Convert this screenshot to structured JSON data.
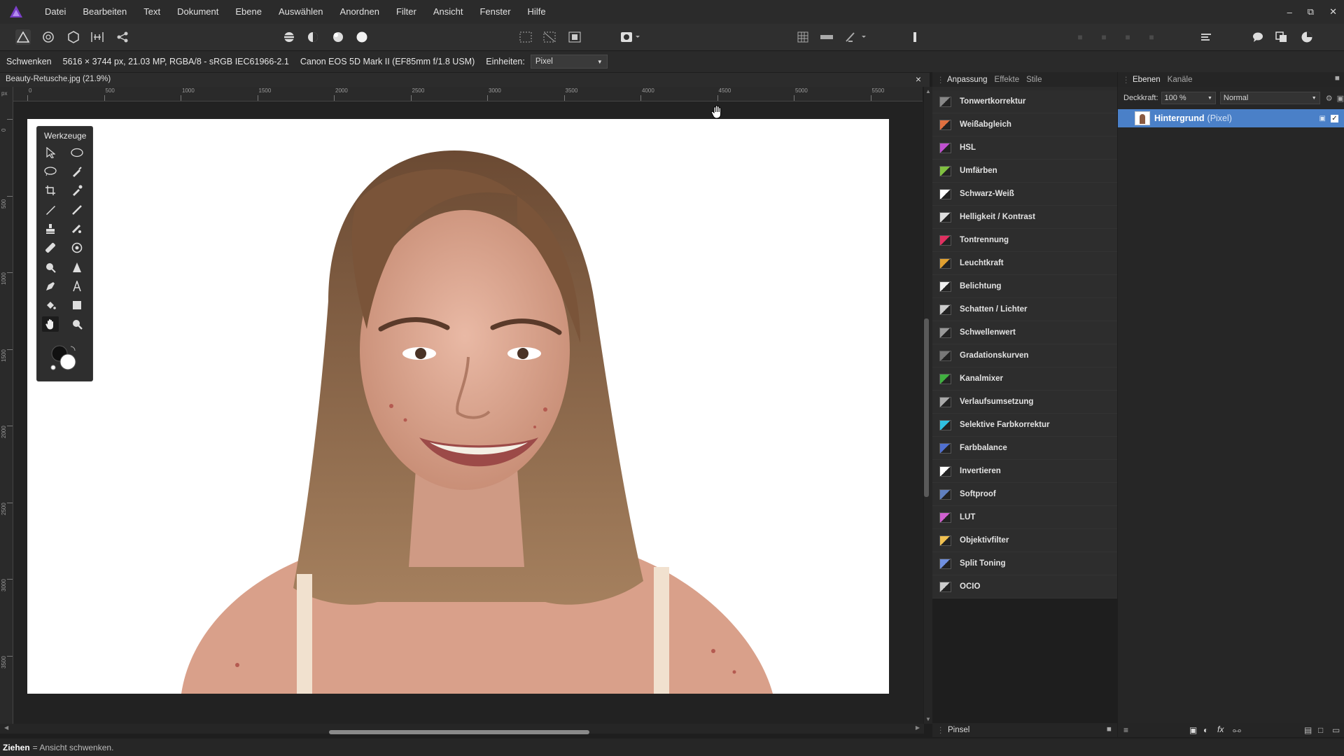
{
  "menu": {
    "items": [
      "Datei",
      "Bearbeiten",
      "Text",
      "Dokument",
      "Ebene",
      "Auswählen",
      "Anordnen",
      "Filter",
      "Ansicht",
      "Fenster",
      "Hilfe"
    ]
  },
  "context_bar": {
    "tool_name": "Schwenken",
    "doc_info": "5616 × 3744 px, 21.03 MP, RGBA/8 - sRGB IEC61966-2.1",
    "camera": "Canon EOS 5D Mark II (EF85mm f/1.8 USM)",
    "units_label": "Einheiten:",
    "units_value": "Pixel"
  },
  "document": {
    "tab_title": "Beauty-Retusche.jpg (21.9%)",
    "close": "×"
  },
  "ruler": {
    "unit": "px",
    "h_labels": [
      "0",
      "500",
      "1000",
      "1500",
      "2000",
      "2500",
      "3000",
      "3500",
      "4000",
      "4500",
      "5000",
      "5500"
    ],
    "v_labels": [
      "0",
      "500",
      "1000",
      "1500",
      "2000",
      "2500",
      "3000",
      "3500"
    ]
  },
  "tools_panel": {
    "title": "Werkzeuge"
  },
  "adjustments": {
    "tabs": [
      "Anpassung",
      "Effekte",
      "Stile"
    ],
    "items": [
      {
        "label": "Tonwertkorrektur",
        "color": "#888888"
      },
      {
        "label": "Weißabgleich",
        "color": "#e07040"
      },
      {
        "label": "HSL",
        "color": "#c050d0"
      },
      {
        "label": "Umfärben",
        "color": "#80c040"
      },
      {
        "label": "Schwarz-Weiß",
        "color": "#ffffff"
      },
      {
        "label": "Helligkeit / Kontrast",
        "color": "#dddddd"
      },
      {
        "label": "Tontrennung",
        "color": "#e03060"
      },
      {
        "label": "Leuchtkraft",
        "color": "#e0a030"
      },
      {
        "label": "Belichtung",
        "color": "#eeeeee"
      },
      {
        "label": "Schatten / Lichter",
        "color": "#cccccc"
      },
      {
        "label": "Schwellenwert",
        "color": "#999999"
      },
      {
        "label": "Gradationskurven",
        "color": "#777777"
      },
      {
        "label": "Kanalmixer",
        "color": "#40b040"
      },
      {
        "label": "Verlaufsumsetzung",
        "color": "#aaaaaa"
      },
      {
        "label": "Selektive Farbkorrektur",
        "color": "#30c0e0"
      },
      {
        "label": "Farbbalance",
        "color": "#5070d0"
      },
      {
        "label": "Invertieren",
        "color": "#ffffff"
      },
      {
        "label": "Softproof",
        "color": "#6080c0"
      },
      {
        "label": "LUT",
        "color": "#d060d0"
      },
      {
        "label": "Objektivfilter",
        "color": "#f0c050"
      },
      {
        "label": "Split Toning",
        "color": "#7090e0"
      },
      {
        "label": "OCIO",
        "color": "#cccccc"
      }
    ]
  },
  "layers": {
    "tabs": [
      "Ebenen",
      "Kanäle"
    ],
    "opacity_label": "Deckkraft:",
    "opacity_value": "100 %",
    "blend_mode": "Normal",
    "layer_name": "Hintergrund",
    "layer_type": "(Pixel)"
  },
  "brush_bar": {
    "label": "Pinsel"
  },
  "status": {
    "bold": "Ziehen",
    "text": "= Ansicht schwenken."
  },
  "colors": {
    "accent": "#4a80c8",
    "panel": "#2b2b2b",
    "background": "#1e1e1e"
  }
}
